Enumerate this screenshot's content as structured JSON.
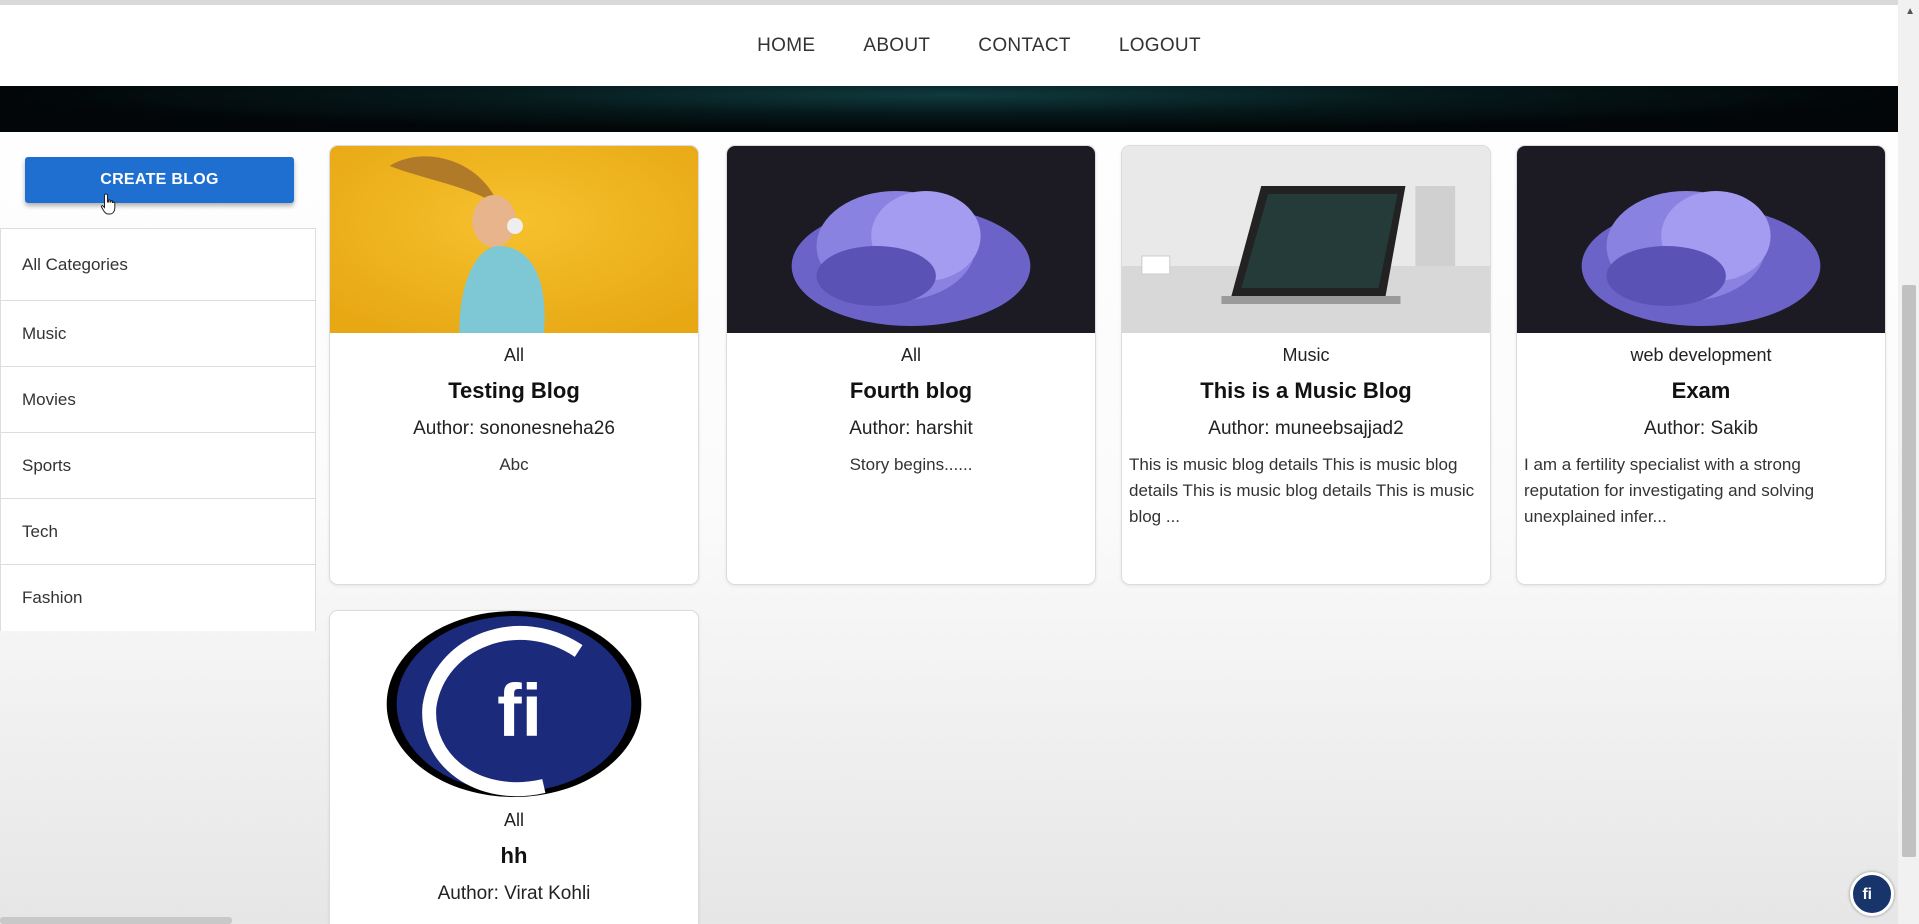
{
  "nav": {
    "home": "HOME",
    "about": "ABOUT",
    "contact": "CONTACT",
    "logout": "LOGOUT"
  },
  "sidebar": {
    "create_button": "CREATE BLOG",
    "categories": [
      "All Categories",
      "Music",
      "Movies",
      "Sports",
      "Tech",
      "Fashion"
    ]
  },
  "posts": [
    {
      "category": "All",
      "title": "Testing Blog",
      "author": "Author: sononesneha26",
      "description": "Abc",
      "image": "woman-headphones-yellow"
    },
    {
      "category": "All",
      "title": "Fourth blog",
      "author": "Author: harshit",
      "description": "Story begins......",
      "image": "purple-abstract-bloom"
    },
    {
      "category": "Music",
      "title": "This is a Music Blog",
      "author": "Author: muneebsajjad2",
      "description": "This is music blog details This is music blog details This is music blog details This is music blog ...",
      "image": "laptop-desk"
    },
    {
      "category": "web development",
      "title": "Exam",
      "author": "Author: Sakib",
      "description": "I am a fertility specialist with a strong reputation for investigating and solving unexplained infer...",
      "image": "purple-abstract-bloom"
    },
    {
      "category": "All",
      "title": "hh",
      "author": "Author: Virat Kohli",
      "description": "",
      "image": "fi-logo"
    }
  ],
  "colors": {
    "primary_button": "#1f6fd0",
    "banner": "#06191b",
    "logo_blue": "#17356b"
  }
}
